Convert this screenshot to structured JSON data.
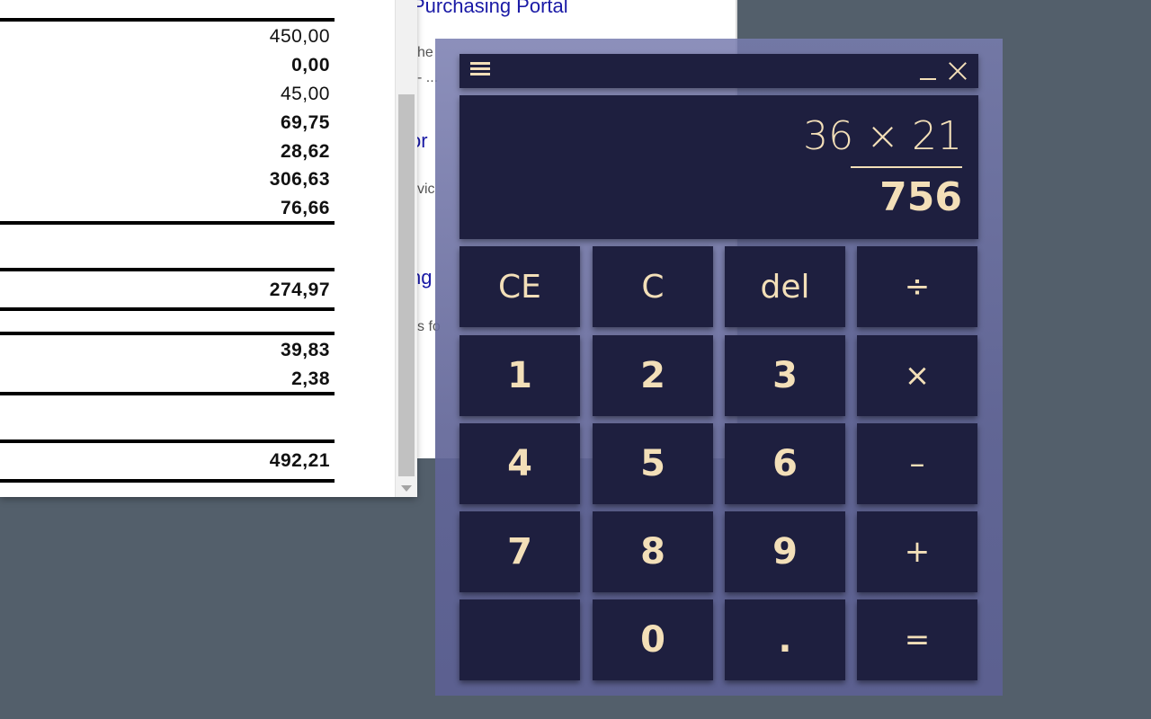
{
  "portal": {
    "title": "Purchasing Portal",
    "line1": "he",
    "line2": "- ...",
    "link1": "or",
    "line3": "vic",
    "link2": "ng",
    "line4": "s fo"
  },
  "report": {
    "values": [
      "450,00",
      "0,00",
      "45,00",
      "69,75",
      "28,62",
      "306,63",
      "76,66",
      "274,97",
      "39,83",
      "2,38",
      "492,21"
    ]
  },
  "calculator": {
    "expression": "36 × 21",
    "result": "756",
    "keys": {
      "ce": "CE",
      "c": "C",
      "del": "del",
      "divide": "÷",
      "one": "1",
      "two": "2",
      "three": "3",
      "multiply": "×",
      "four": "4",
      "five": "5",
      "six": "6",
      "minus": "–",
      "seven": "7",
      "eight": "8",
      "nine": "9",
      "plus": "+",
      "blank": "",
      "zero": "0",
      "dot": ".",
      "equals": "="
    },
    "colors": {
      "panel": "#1e1f3f",
      "text": "#f3dfb8",
      "frame": "#6a6d9c"
    },
    "icons": [
      "menu-icon",
      "minimize-icon",
      "close-icon"
    ]
  }
}
